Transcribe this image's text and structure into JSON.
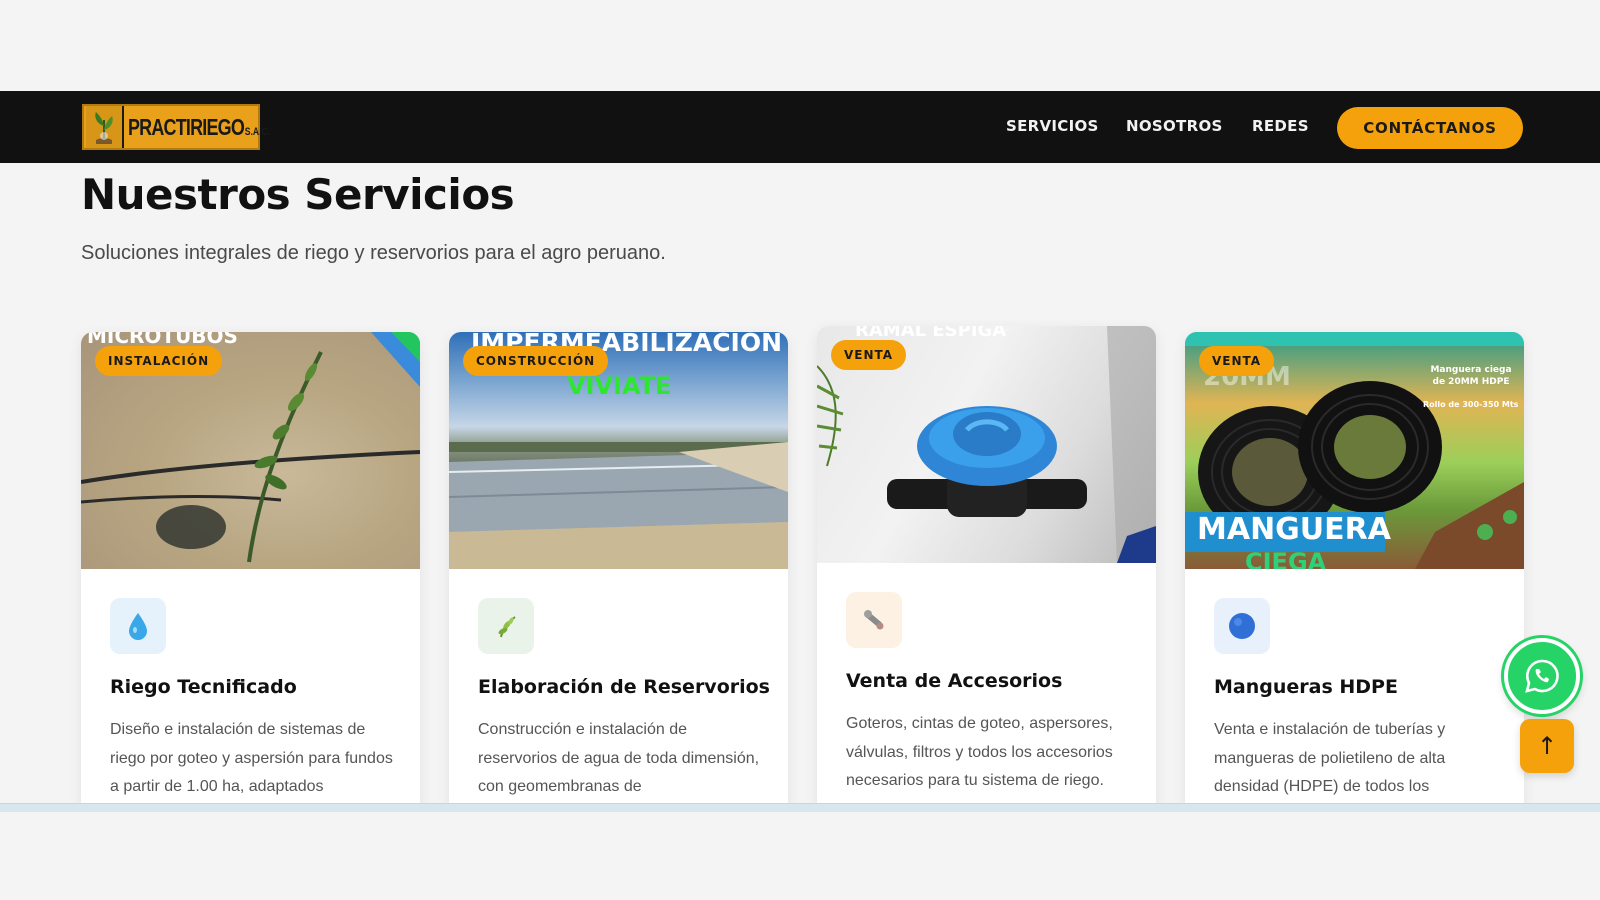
{
  "brand": {
    "name": "PRACTIRIEGO",
    "suffix": "S.A.C."
  },
  "nav": {
    "links": [
      "SERVICIOS",
      "NOSOTROS",
      "REDES"
    ],
    "cta": "CONTÁCTANOS"
  },
  "section": {
    "title": "Nuestros Servicios",
    "subtitle": "Soluciones integrales de riego y reservorios para el agro peruano."
  },
  "cards": [
    {
      "badge": "INSTALACIÓN",
      "image_caption": "MICROTUBOS",
      "icon": "droplet-icon",
      "title": "Riego Tecnificado",
      "description": "Diseño e instalación de sistemas de riego por goteo y aspersión para fundos a partir de 1.00 ha, adaptados"
    },
    {
      "badge": "CONSTRUCCIÓN",
      "image_caption": "IMPERMEABILIZACION",
      "image_caption_2": "VIVIATE",
      "icon": "plant-icon",
      "title": "Elaboración de Reservorios",
      "description": "Construcción e instalación de reservorios de agua de toda dimensión, con geomembranas de"
    },
    {
      "badge": "VENTA",
      "image_caption": "RAMAL ESPIGA",
      "icon": "wrench-icon",
      "title": "Venta de Accesorios",
      "description": "Goteros, cintas de goteo, aspersores, válvulas, filtros y todos los accesorios necesarios para tu sistema de riego."
    },
    {
      "badge": "VENTA",
      "image_caption": "20MM",
      "image_caption_2": "MANGUERA",
      "image_caption_3": "CIEGA",
      "image_note_1": "Manguera ciega de 20MM HDPE",
      "image_note_2": "Rollo de 300-350 Mts",
      "icon": "circle-icon",
      "title": "Mangueras HDPE",
      "description": "Venta e instalación de tuberías y mangueras de polietileno de alta densidad (HDPE) de todos los"
    }
  ],
  "floating": {
    "whatsapp": "whatsapp-icon",
    "scroll_top": "↑"
  },
  "colors": {
    "accent": "#f5a10b",
    "nav_bg": "#111111",
    "whatsapp": "#25d366"
  }
}
